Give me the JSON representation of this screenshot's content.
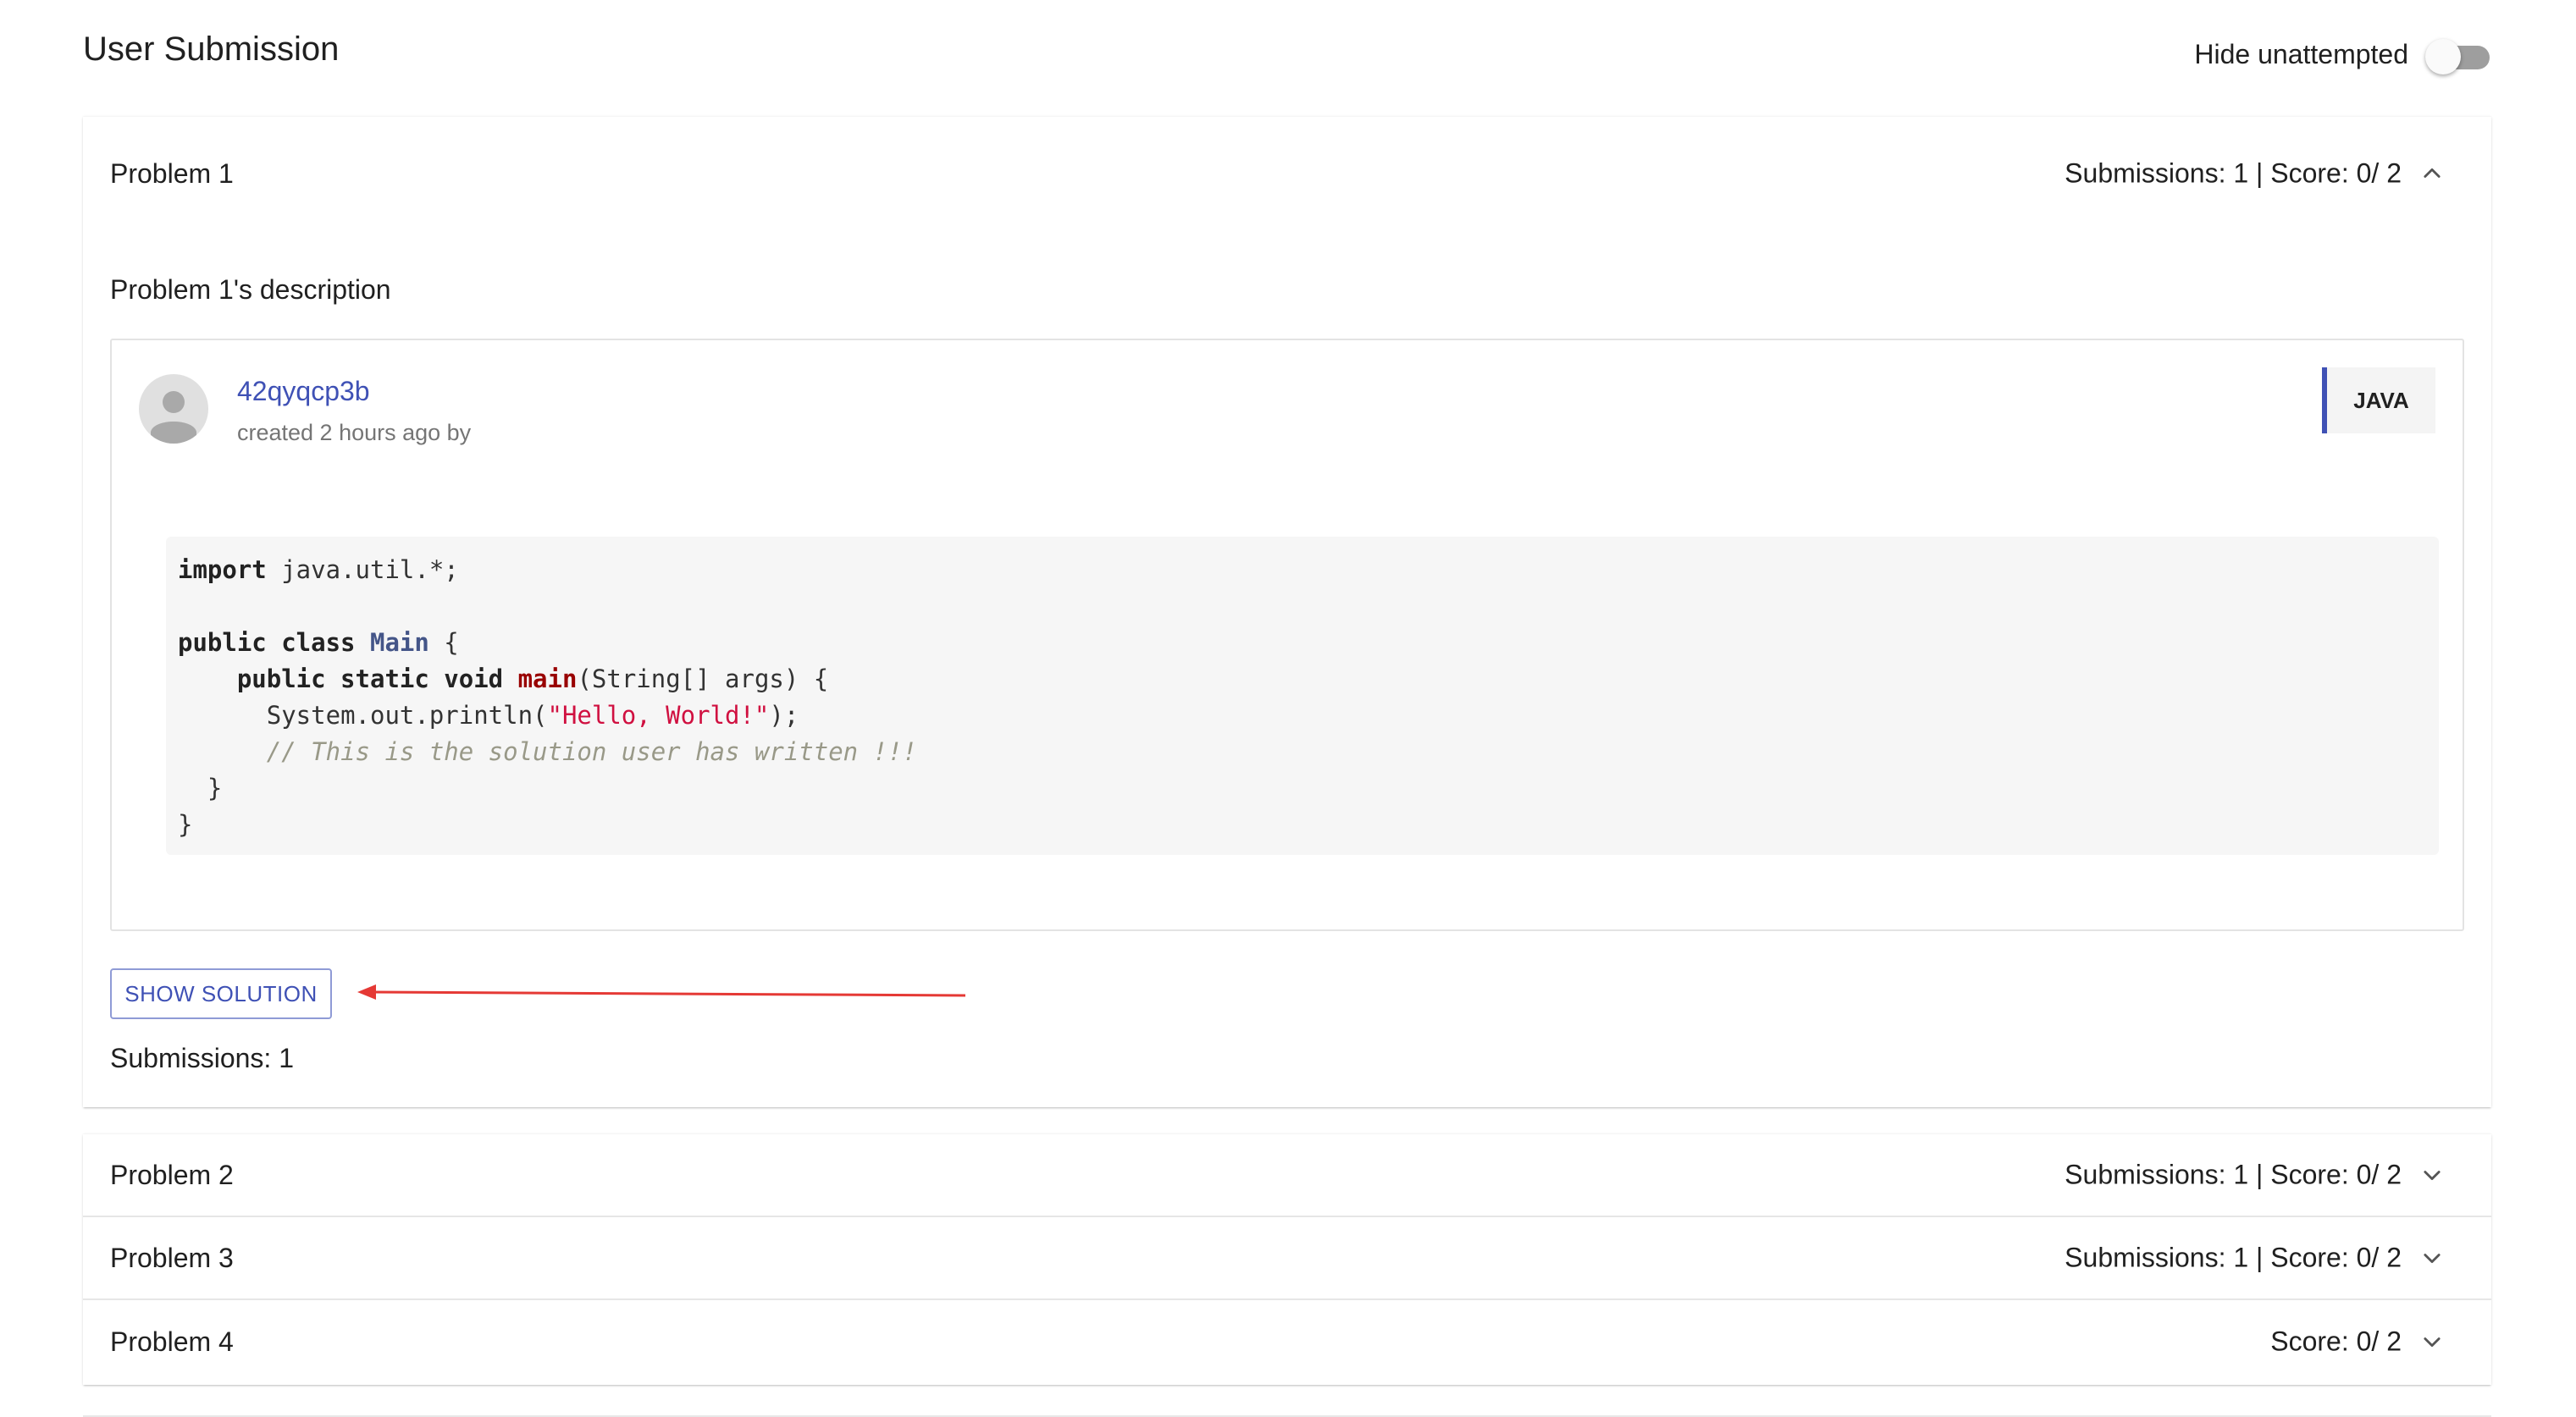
{
  "page": {
    "title": "User Submission"
  },
  "filter": {
    "hide_unattempted_label": "Hide unattempted",
    "hide_unattempted_on": false
  },
  "problems": [
    {
      "title": "Problem 1",
      "meta": "Submissions: 1 | Score: 0/ 2",
      "expanded": true,
      "description": "Problem 1's description",
      "submission": {
        "id": "42qyqcp3b",
        "created": "created 2 hours ago by",
        "language": "JAVA",
        "code": {
          "line1_kw": "import",
          "line1_rest": " java.util.*;",
          "line3_kw": "public class",
          "line3_cls": "Main",
          "line3_rest": " {",
          "line4_kw": "public static void",
          "line4_fn": "main",
          "line4_rest": "(String[] args) {",
          "line5_pre": "System.out.println(",
          "line5_str": "\"Hello, World!\"",
          "line5_post": ");",
          "line6_cmt": "// This is the solution user has written !!!",
          "line7": "}",
          "line8": "}"
        }
      },
      "show_solution_label": "SHOW SOLUTION",
      "submissions_count": "Submissions: 1"
    },
    {
      "title": "Problem 2",
      "meta": "Submissions: 1 | Score: 0/ 2",
      "expanded": false
    },
    {
      "title": "Problem 3",
      "meta": "Submissions: 1 | Score: 0/ 2",
      "expanded": false
    },
    {
      "title": "Problem 4",
      "meta": "Score: 0/ 2",
      "expanded": false
    }
  ],
  "icons": {
    "expand_less": "chevron-up-icon",
    "expand_more": "chevron-down-icon",
    "avatar": "person-icon",
    "annotation": "red-arrow-annotation"
  },
  "colors": {
    "primary": "#3f51b5",
    "annotation_arrow": "#e53935",
    "code_bg": "#f6f6f6"
  }
}
